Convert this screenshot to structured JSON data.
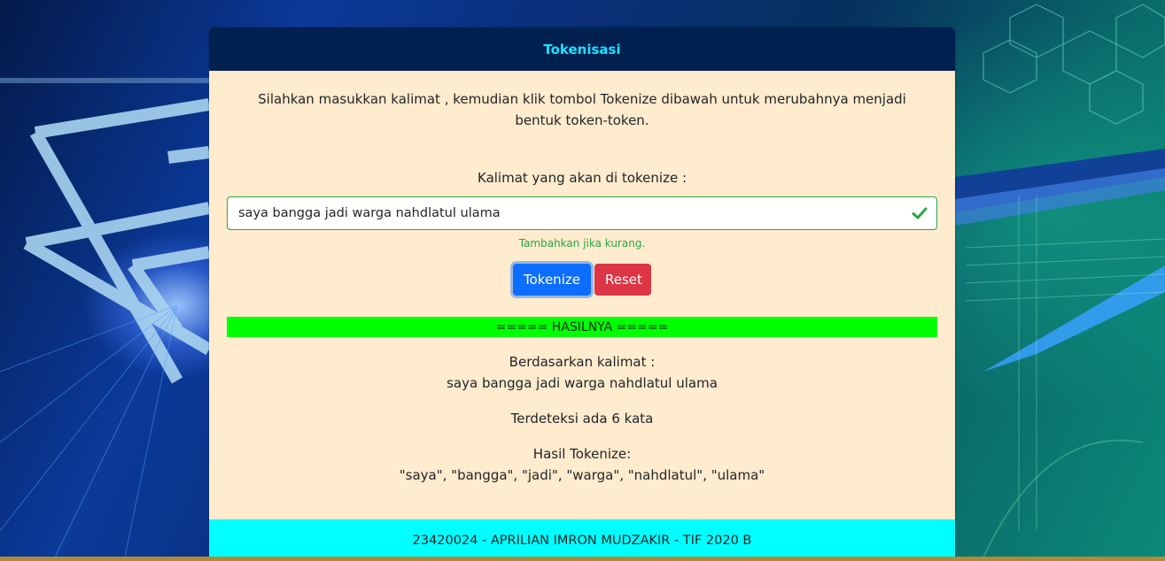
{
  "header": {
    "title": "Tokenisasi"
  },
  "intro": {
    "text": "Silahkan masukkan kalimat , kemudian klik tombol Tokenize dibawah untuk merubahnya menjadi bentuk token-token."
  },
  "form": {
    "label": "Kalimat yang akan di tokenize :",
    "input_value": "saya bangga jadi warga nahdlatul ulama",
    "help": "Tambahkan jika kurang.",
    "tokenize_label": "Tokenize",
    "reset_label": "Reset"
  },
  "result": {
    "banner": "===== HASILNYA =====",
    "based_label": "Berdasarkan kalimat :",
    "sentence": "saya bangga jadi warga nahdlatul ulama",
    "count_text": "Terdeteksi ada 6 kata",
    "tokens_label": "Hasil Tokenize:",
    "tokens": "\"saya\", \"bangga\", \"jadi\", \"warga\", \"nahdlatul\", \"ulama\""
  },
  "footer": {
    "text": "23420024 - APRILIAN IMRON MUDZAKIR - TIF 2020 B"
  },
  "colors": {
    "header_bg": "#00204f",
    "header_text": "#1ee0ff",
    "card_bg": "#ffebcd",
    "success": "#28a745",
    "primary": "#0d6efd",
    "danger": "#dc3545",
    "banner_bg": "#00ff00",
    "footer_bg": "#00ffff"
  },
  "icons": {
    "valid": "check-icon"
  }
}
